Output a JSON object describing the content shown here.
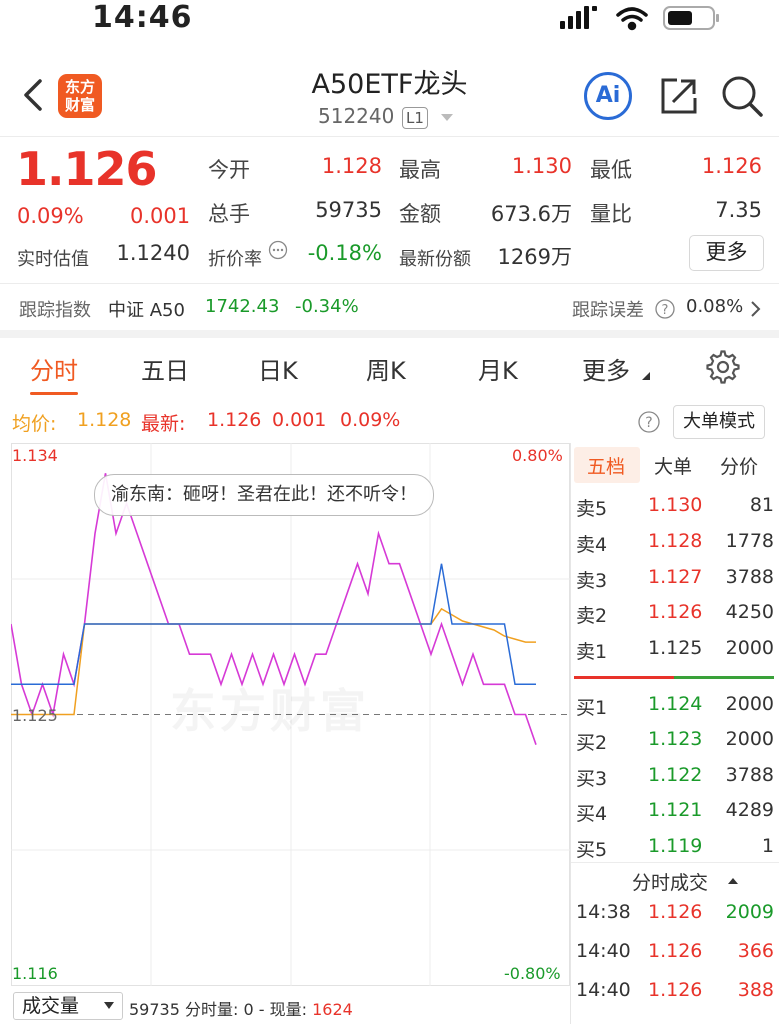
{
  "status_bar": {
    "time": "14:46"
  },
  "header": {
    "title": "A50ETF龙头",
    "code": "512240",
    "level": "L1",
    "logo_line1": "东方",
    "logo_line2": "财富",
    "ai_label": "Ai"
  },
  "quote": {
    "price": "1.126",
    "change_pct": "0.09%",
    "change_abs": "0.001",
    "iopv_label": "实时估值",
    "iopv_value": "1.1240",
    "open_label": "今开",
    "open_value": "1.128",
    "high_label": "最高",
    "high_value": "1.130",
    "low_label": "最低",
    "low_value": "1.126",
    "volume_label": "总手",
    "volume_value": "59735",
    "amount_label": "金额",
    "amount_value": "673.6万",
    "vol_ratio_label": "量比",
    "vol_ratio_value": "7.35",
    "discount_label": "折价率",
    "discount_value": "-0.18%",
    "shares_label": "最新份额",
    "shares_value": "1269万",
    "more_label": "更多"
  },
  "tracking": {
    "label": "跟踪指数",
    "index_name": "中证 A50",
    "index_value": "1742.43",
    "index_change": "-0.34%",
    "error_label": "跟踪误差",
    "error_value": "0.08%"
  },
  "tabs": [
    "分时",
    "五日",
    "日K",
    "周K",
    "月K",
    "更多"
  ],
  "chart_info": {
    "avg_label": "均价:",
    "avg_value": "1.128",
    "last_label": "最新:",
    "last_value": "1.126",
    "last_change": "0.001",
    "last_pct": "0.09%",
    "big_order_mode": "大单模式"
  },
  "chart_axis": {
    "y_top": "1.134",
    "y_bottom": "1.116",
    "y_ref": "1.125",
    "pct_top": "0.80%",
    "pct_bottom": "-0.80%"
  },
  "chart_tooltip": "渝东南：砸呀！圣君在此！还不听令！",
  "watermark": "东方财富",
  "chart_data": {
    "type": "line",
    "ylim": [
      1.116,
      1.134
    ],
    "reference": 1.125,
    "series": [
      {
        "name": "最新",
        "color": "#d63ad6",
        "values": [
          1.128,
          1.126,
          1.125,
          1.126,
          1.125,
          1.127,
          1.126,
          1.128,
          1.131,
          1.133,
          1.131,
          1.132,
          1.131,
          1.13,
          1.129,
          1.128,
          1.128,
          1.127,
          1.127,
          1.127,
          1.126,
          1.127,
          1.126,
          1.127,
          1.126,
          1.127,
          1.126,
          1.127,
          1.126,
          1.127,
          1.127,
          1.128,
          1.129,
          1.13,
          1.129,
          1.131,
          1.13,
          1.13,
          1.129,
          1.128,
          1.127,
          1.128,
          1.127,
          1.126,
          1.127,
          1.126,
          1.126,
          1.126,
          1.125,
          1.125,
          1.124
        ]
      },
      {
        "name": "均价",
        "color": "#f0a020",
        "values": [
          1.125,
          1.125,
          1.125,
          1.125,
          1.125,
          1.125,
          1.125,
          1.128,
          1.128,
          1.128,
          1.128,
          1.128,
          1.128,
          1.128,
          1.128,
          1.128,
          1.128,
          1.128,
          1.128,
          1.128,
          1.128,
          1.128,
          1.128,
          1.128,
          1.128,
          1.128,
          1.128,
          1.128,
          1.128,
          1.128,
          1.128,
          1.128,
          1.128,
          1.128,
          1.128,
          1.128,
          1.128,
          1.128,
          1.128,
          1.128,
          1.128,
          1.1285,
          1.1283,
          1.1281,
          1.128,
          1.1279,
          1.1278,
          1.1276,
          1.1275,
          1.1274,
          1.1274
        ]
      },
      {
        "name": "",
        "color": "#2a6bd6",
        "values": [
          1.126,
          1.126,
          1.126,
          1.126,
          1.126,
          1.126,
          1.126,
          1.128,
          1.128,
          1.128,
          1.128,
          1.128,
          1.128,
          1.128,
          1.128,
          1.128,
          1.128,
          1.128,
          1.128,
          1.128,
          1.128,
          1.128,
          1.128,
          1.128,
          1.128,
          1.128,
          1.128,
          1.128,
          1.128,
          1.128,
          1.128,
          1.128,
          1.128,
          1.128,
          1.128,
          1.128,
          1.128,
          1.128,
          1.128,
          1.128,
          1.128,
          1.13,
          1.128,
          1.128,
          1.128,
          1.128,
          1.128,
          1.128,
          1.126,
          1.126,
          1.126
        ]
      }
    ]
  },
  "orderbook": {
    "tabs": [
      "五档",
      "大单",
      "分价"
    ],
    "asks": [
      {
        "label": "卖5",
        "price": "1.130",
        "qty": "81"
      },
      {
        "label": "卖4",
        "price": "1.128",
        "qty": "1778"
      },
      {
        "label": "卖3",
        "price": "1.127",
        "qty": "3788"
      },
      {
        "label": "卖2",
        "price": "1.126",
        "qty": "4250"
      },
      {
        "label": "卖1",
        "price": "1.125",
        "qty": "2000"
      }
    ],
    "bids": [
      {
        "label": "买1",
        "price": "1.124",
        "qty": "2000"
      },
      {
        "label": "买2",
        "price": "1.123",
        "qty": "2000"
      },
      {
        "label": "买3",
        "price": "1.122",
        "qty": "3788"
      },
      {
        "label": "买4",
        "price": "1.121",
        "qty": "4289"
      },
      {
        "label": "买5",
        "price": "1.119",
        "qty": "1"
      }
    ]
  },
  "ticks": {
    "title": "分时成交",
    "rows": [
      {
        "time": "14:38",
        "price": "1.126",
        "qty": "2009"
      },
      {
        "time": "14:40",
        "price": "1.126",
        "qty": "366"
      },
      {
        "time": "14:40",
        "price": "1.126",
        "qty": "388"
      }
    ]
  },
  "volume_bar": {
    "selector": "成交量",
    "total": "59735",
    "fen_label": "分时量: 0 - 现量:",
    "current": "1624"
  }
}
